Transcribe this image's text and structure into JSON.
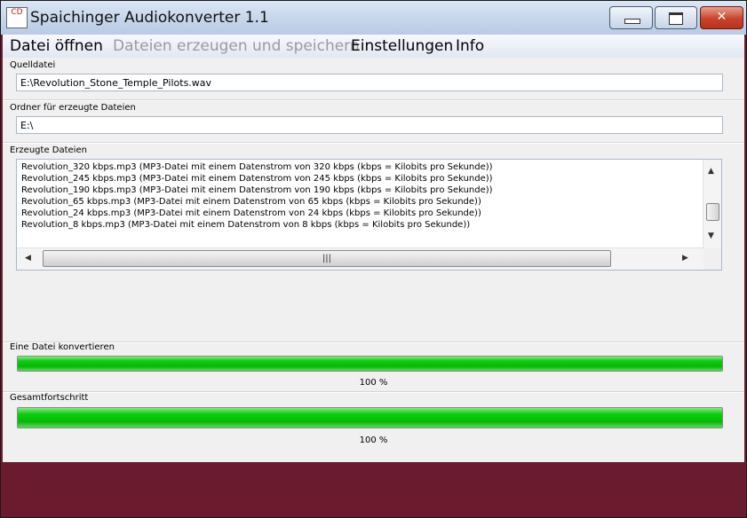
{
  "window": {
    "title": "Spaichinger Audiokonverter 1.1",
    "app_icon_glyph": "CD",
    "minimize_glyph": "",
    "maximize_glyph": "",
    "close_glyph": "✕"
  },
  "menu": {
    "items": [
      {
        "label": "Datei öffnen",
        "enabled": true
      },
      {
        "label": "Dateien erzeugen und speichern",
        "enabled": false
      },
      {
        "label": "Einstellungen",
        "enabled": true
      },
      {
        "label": "Info",
        "enabled": true
      }
    ]
  },
  "source": {
    "label": "Quelldatei",
    "value": "E:\\Revolution_Stone_Temple_Pilots.wav"
  },
  "output_folder": {
    "label": "Ordner für erzeugte Dateien",
    "value": "E:\\"
  },
  "generated": {
    "label": "Erzeugte Dateien",
    "rows": [
      "Revolution_320 kbps.mp3  (MP3-Datei mit einem Datenstrom von 320 kbps (kbps = Kilobits pro Sekunde))",
      "Revolution_245 kbps.mp3  (MP3-Datei mit einem Datenstrom von 245 kbps (kbps = Kilobits pro Sekunde))",
      "Revolution_190 kbps.mp3  (MP3-Datei mit einem Datenstrom von 190 kbps (kbps = Kilobits pro Sekunde))",
      "Revolution_65 kbps.mp3  (MP3-Datei mit einem Datenstrom von 65 kbps (kbps = Kilobits pro Sekunde))",
      "Revolution_24 kbps.mp3  (MP3-Datei mit einem Datenstrom von 24 kbps (kbps = Kilobits pro Sekunde))",
      "Revolution_8 kbps.mp3  (MP3-Datei mit einem Datenstrom von 8 kbps (kbps = Kilobits pro Sekunde))"
    ],
    "scroll_up_glyph": "▲",
    "scroll_down_glyph": "▼",
    "scroll_left_glyph": "◀",
    "scroll_right_glyph": "▶",
    "thumb_grip_glyph": "|||"
  },
  "progress_file": {
    "label": "Eine Datei konvertieren",
    "fraction": 1.0,
    "text": "100 %"
  },
  "progress_total": {
    "label": "Gesamtfortschritt",
    "fraction": 1.0,
    "text": "100 %"
  },
  "colors": {
    "progress_green": "#0ecf0e",
    "desktop_background": "#6a1b2e"
  }
}
